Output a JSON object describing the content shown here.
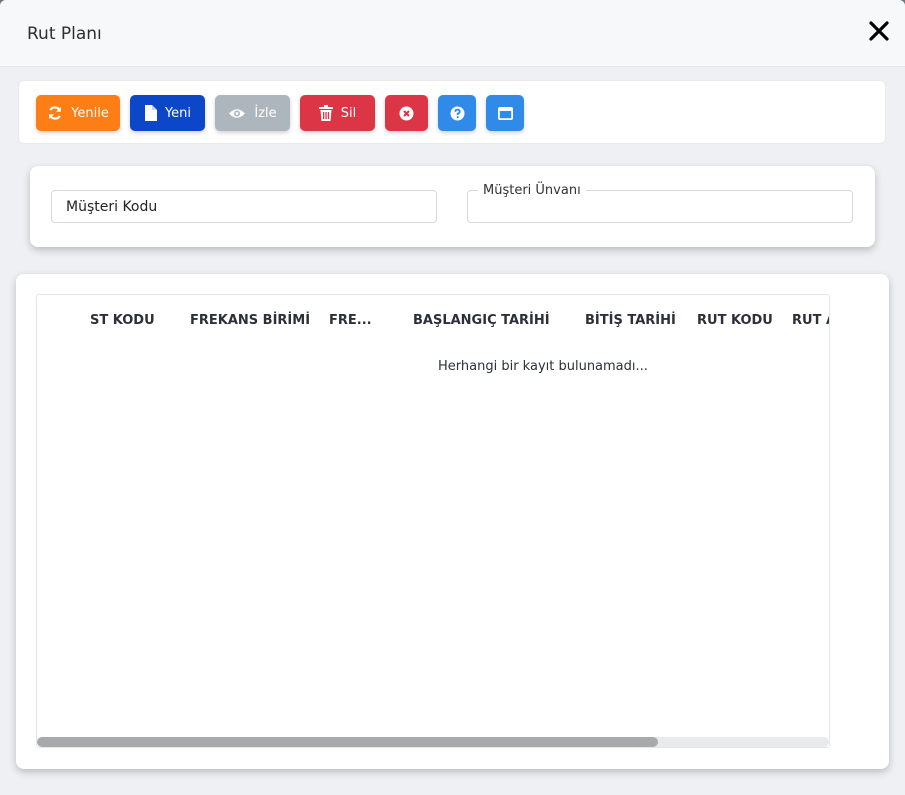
{
  "modal": {
    "title": "Rut Planı"
  },
  "toolbar": {
    "refresh": {
      "label": "Yenile",
      "icon": "refresh-icon",
      "color": "#fd7e14"
    },
    "new": {
      "label": "Yeni",
      "icon": "file-icon",
      "color": "#0d47c9"
    },
    "view": {
      "label": "İzle",
      "icon": "eye-icon",
      "color": "#adb5bd"
    },
    "delete": {
      "label": "Sil",
      "icon": "trash-icon",
      "color": "#dc3545"
    },
    "cancel": {
      "icon": "times-circle-icon",
      "color": "#dc3545"
    },
    "help": {
      "icon": "question-circle-icon",
      "color": "#2f8ae8"
    },
    "window": {
      "icon": "window-icon",
      "color": "#2f8ae8"
    }
  },
  "filters": {
    "customer_code": {
      "placeholder": "Müşteri Kodu",
      "value": ""
    },
    "customer_title": {
      "legend": "Müşteri Ünvanı",
      "value": ""
    }
  },
  "grid": {
    "columns": [
      "ST KODU",
      "FREKANS BİRİMİ",
      "FRE...",
      "BAŞLANGIÇ TARİHİ",
      "BİTİŞ TARİHİ",
      "RUT KODU",
      "RUT A"
    ],
    "empty_message": "Herhangi bir kayıt bulunamadı..."
  },
  "colors": {
    "background": "#eef0f4",
    "card": "#ffffff",
    "scroll_thumb": "#a7a9ac"
  }
}
